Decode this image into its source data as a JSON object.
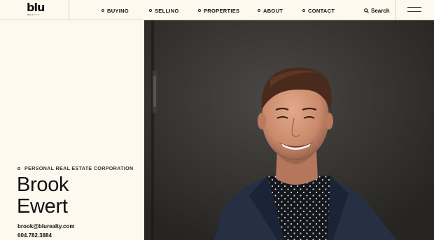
{
  "header": {
    "logo_text": "blu",
    "logo_subtext": "REALTY",
    "nav": [
      {
        "label": "BUYING"
      },
      {
        "label": "SELLING"
      },
      {
        "label": "PROPERTIES"
      },
      {
        "label": "ABOUT"
      },
      {
        "label": "CONTACT"
      }
    ],
    "search_label": "Search",
    "search_icon": "search-icon",
    "menu_icon": "hamburger-menu-icon"
  },
  "agent": {
    "title": "PERSONAL REAL ESTATE CORPORATION",
    "first_name": "Brook",
    "last_name": "Ewert",
    "email": "brook@blurealty.com",
    "phone": "604.782.3884"
  },
  "colors": {
    "background": "#fdf9ef",
    "text": "#111111",
    "photo_bg": "#2e2d2b"
  }
}
